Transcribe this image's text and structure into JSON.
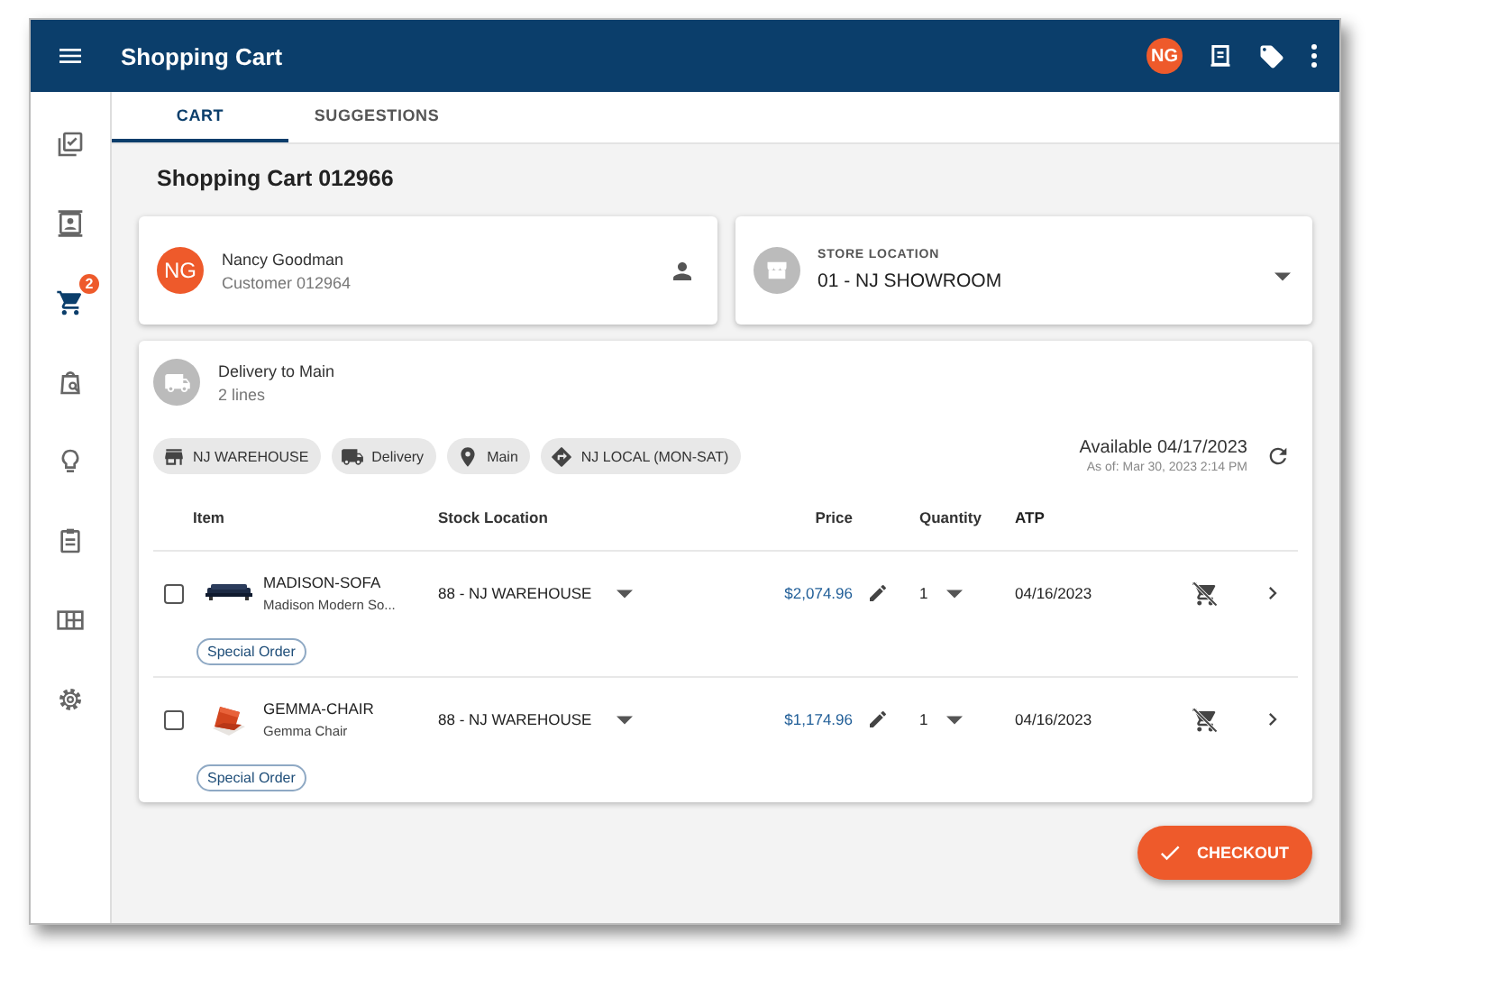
{
  "app_bar": {
    "title": "Shopping Cart",
    "avatar": "NG"
  },
  "sidebar": {
    "items": [
      {
        "kind": "checklist",
        "selected": false
      },
      {
        "kind": "contact",
        "selected": false
      },
      {
        "kind": "cart",
        "selected": true,
        "badge": "2"
      },
      {
        "kind": "search",
        "selected": false
      },
      {
        "kind": "idea",
        "selected": false
      },
      {
        "kind": "clipboard",
        "selected": false
      },
      {
        "kind": "grid",
        "selected": false
      },
      {
        "kind": "settings",
        "selected": false
      }
    ]
  },
  "tabs": [
    {
      "label": "CART",
      "selected": true
    },
    {
      "label": "SUGGESTIONS",
      "selected": false
    }
  ],
  "heading": "Shopping Cart 012966",
  "customer": {
    "initials": "NG",
    "name": "Nancy Goodman",
    "subtitle": "Customer 012964"
  },
  "store": {
    "label": "STORE LOCATION",
    "value": "01 - NJ SHOWROOM"
  },
  "delivery": {
    "title": "Delivery to Main",
    "subtitle": "2 lines",
    "chips": [
      {
        "kind": "store",
        "label": "NJ WAREHOUSE"
      },
      {
        "kind": "truck",
        "label": "Delivery"
      },
      {
        "kind": "pin",
        "label": "Main"
      },
      {
        "kind": "route",
        "label": "NJ LOCAL (MON-SAT)"
      }
    ],
    "available": "Available 04/17/2023",
    "as_of": "As of: Mar 30, 2023 2:14 PM"
  },
  "table": {
    "columns": [
      "Item",
      "Stock Location",
      "Price",
      "Quantity",
      "ATP"
    ],
    "rows": [
      {
        "checked": false,
        "sku": "MADISON-SOFA",
        "name": "Madison Modern So...",
        "stock_location": "88 - NJ WAREHOUSE",
        "price": "$2,074.96",
        "quantity": "1",
        "atp": "04/16/2023",
        "badge": "Special Order"
      },
      {
        "checked": false,
        "sku": "GEMMA-CHAIR",
        "name": "Gemma Chair",
        "stock_location": "88 - NJ WAREHOUSE",
        "price": "$1,174.96",
        "quantity": "1",
        "atp": "04/16/2023",
        "badge": "Special Order"
      }
    ]
  },
  "checkout": "CHECKOUT"
}
